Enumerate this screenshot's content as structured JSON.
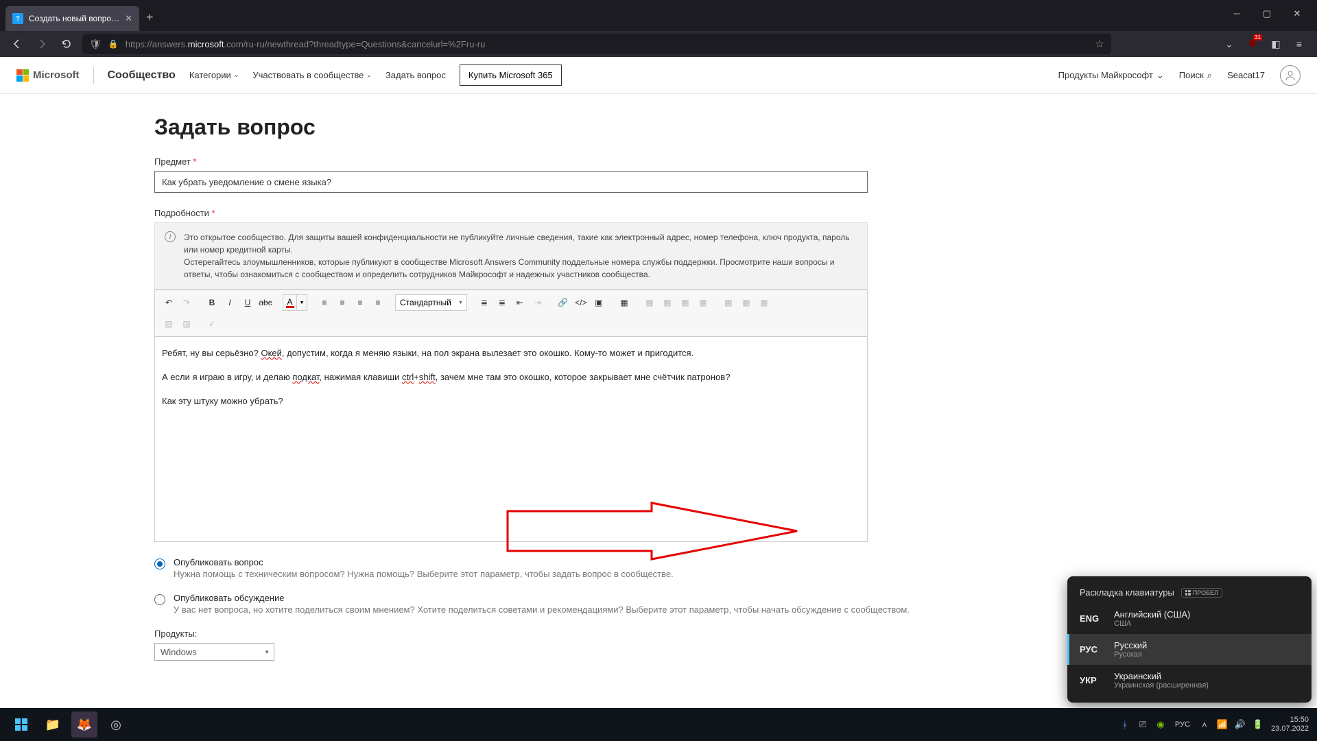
{
  "browser": {
    "tab_title": "Создать новый вопрос или на",
    "url_prefix": "https://answers.",
    "url_domain": "microsoft",
    "url_suffix": ".com/ru-ru/newthread?threadtype=Questions&cancelurl=%2Fru-ru",
    "ublock_badge": "31"
  },
  "header": {
    "brand": "Microsoft",
    "community": "Сообщество",
    "nav_categories": "Категории",
    "nav_participate": "Участвовать в сообществе",
    "nav_ask": "Задать вопрос",
    "buy365": "Купить Microsoft 365",
    "products": "Продукты Майкрософт",
    "search": "Поиск",
    "username": "Seacat17"
  },
  "form": {
    "title": "Задать вопрос",
    "subject_label": "Предмет",
    "required": "*",
    "subject_value": "Как убрать уведомление о смене языка?",
    "details_label": "Подробности",
    "notice_line1": "Это открытое сообщество. Для защиты вашей конфиденциальности не публикуйте личные сведения, такие как электронный адрес, номер телефона, ключ продукта, пароль или номер кредитной карты.",
    "notice_line2": "Остерегайтесь злоумышленников, которые публикуют в сообществе Microsoft Answers Community поддельные номера службы поддержки.  Просмотрите наши вопросы и ответы, чтобы ознакомиться с сообществом и определить сотрудников Майкрософт и надежных участников сообщества.",
    "style_select": "Стандартный",
    "body": {
      "p1a": "Ребят, ну вы серьёзно? ",
      "p1_sq1": "Окей",
      "p1b": ", допустим, когда я меняю языки, на пол экрана вылезает это окошко. Кому-то может и пригодится.",
      "p2a": "А если я играю в игру, и делаю ",
      "p2_sq1": "подкат",
      "p2b": ", нажимая клавиши ",
      "p2_sq2": "ctrl",
      "p2c": "+",
      "p2_sq3": "shift",
      "p2d": ", зачем мне там это окошко, которое закрывает мне счётчик патронов?",
      "p3": "Как эту штуку можно убрать?"
    },
    "radio1_title": "Опубликовать вопрос",
    "radio1_desc": "Нужна помощь с техническим вопросом? Нужна помощь? Выберите этот параметр, чтобы задать вопрос в сообществе.",
    "radio2_title": "Опубликовать обсуждение",
    "radio2_desc": "У вас нет вопроса, но хотите поделиться своим мнением? Хотите поделиться советами и рекомендациями? Выберите этот параметр, чтобы начать обсуждение с сообществом.",
    "products_label": "Продукты:",
    "products_value": "Windows"
  },
  "lang_popup": {
    "header": "Раскладка клавиатуры",
    "key": "ПРОБЕЛ",
    "items": [
      {
        "code": "ENG",
        "name": "Английский (США)",
        "desc": "США"
      },
      {
        "code": "РУС",
        "name": "Русский",
        "desc": "Русская"
      },
      {
        "code": "УКР",
        "name": "Украинский",
        "desc": "Украинская (расширенная)"
      }
    ]
  },
  "taskbar": {
    "lang": "РУС",
    "time": "15:50",
    "date": "23.07.2022"
  }
}
